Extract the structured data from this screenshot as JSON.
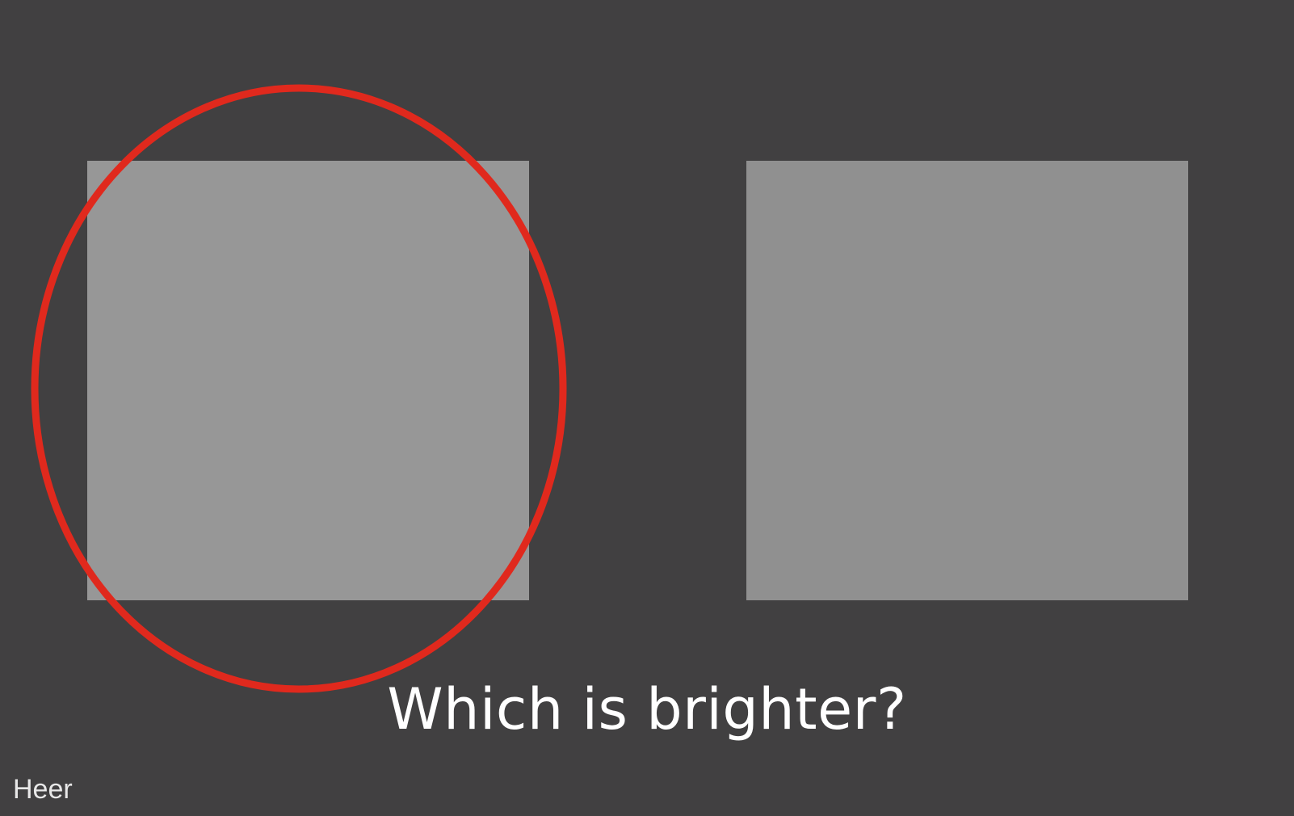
{
  "slide": {
    "background": "#414041",
    "swatches": [
      {
        "name": "left",
        "color": "#979797"
      },
      {
        "name": "right",
        "color": "#909090"
      }
    ],
    "highlight": {
      "target": "left",
      "color": "#e0291d"
    },
    "question": "Which is brighter?",
    "credit": "Heer"
  }
}
